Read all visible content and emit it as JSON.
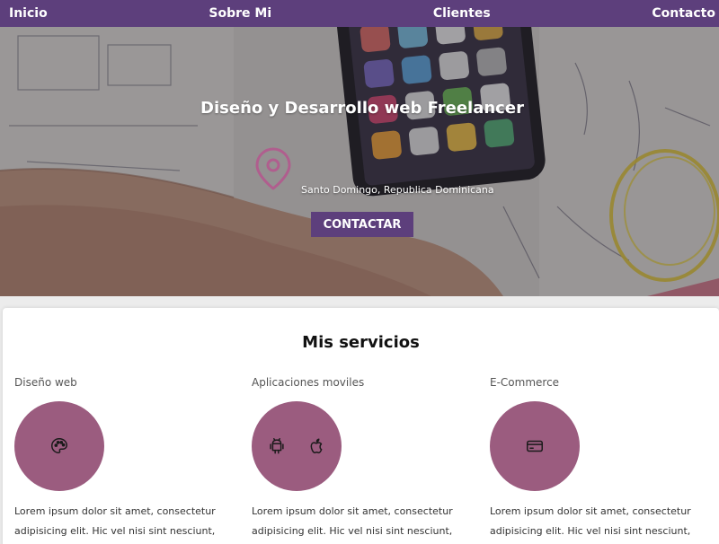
{
  "nav": {
    "items": [
      "Inicio",
      "Sobre Mi",
      "Clientes",
      "Contacto"
    ]
  },
  "hero": {
    "title": "Diseño y Desarrollo web Freelancer",
    "location": "Santo Domingo, Republica Dominicana",
    "button_label": "CONTACTAR",
    "pin_icon": "location-pin-icon"
  },
  "services": {
    "heading": "Mis servicios",
    "items": [
      {
        "title": "Diseño web",
        "icons": [
          "palette-icon"
        ],
        "description": "Lorem ipsum dolor sit amet, consectetur adipisicing elit. Hic vel nisi sint nesciunt, iusto"
      },
      {
        "title": "Aplicaciones moviles",
        "icons": [
          "android-icon",
          "apple-icon"
        ],
        "description": "Lorem ipsum dolor sit amet, consectetur adipisicing elit. Hic vel nisi sint nesciunt, iusto"
      },
      {
        "title": "E-Commerce",
        "icons": [
          "credit-card-icon"
        ],
        "description": "Lorem ipsum dolor sit amet, consectetur adipisicing elit. Hic vel nisi sint nesciunt, iusto"
      }
    ]
  },
  "colors": {
    "nav_bg": "#5d3f7c",
    "button_bg": "#5d3f7c",
    "service_circle": "#9b5c7f",
    "pin": "#b05e8e"
  }
}
